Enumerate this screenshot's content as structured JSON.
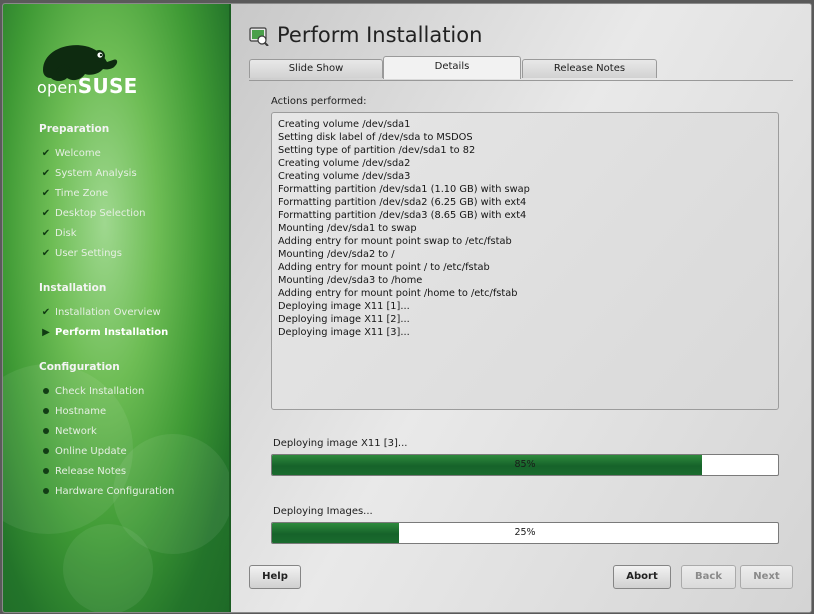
{
  "logo": {
    "prefix": "open",
    "brand": "SUSE"
  },
  "sidebar": {
    "sections": [
      {
        "title": "Preparation",
        "steps": [
          {
            "label": "Welcome",
            "state": "done"
          },
          {
            "label": "System Analysis",
            "state": "done"
          },
          {
            "label": "Time Zone",
            "state": "done"
          },
          {
            "label": "Desktop Selection",
            "state": "done"
          },
          {
            "label": "Disk",
            "state": "done"
          },
          {
            "label": "User Settings",
            "state": "done"
          }
        ]
      },
      {
        "title": "Installation",
        "steps": [
          {
            "label": "Installation Overview",
            "state": "done"
          },
          {
            "label": "Perform Installation",
            "state": "current"
          }
        ]
      },
      {
        "title": "Configuration",
        "steps": [
          {
            "label": "Check Installation",
            "state": "pending"
          },
          {
            "label": "Hostname",
            "state": "pending"
          },
          {
            "label": "Network",
            "state": "pending"
          },
          {
            "label": "Online Update",
            "state": "pending"
          },
          {
            "label": "Release Notes",
            "state": "pending"
          },
          {
            "label": "Hardware Configuration",
            "state": "pending"
          }
        ]
      }
    ]
  },
  "main": {
    "title": "Perform Installation",
    "tabs": [
      {
        "label": "Slide Show",
        "active": false
      },
      {
        "label": "Details",
        "active": true
      },
      {
        "label": "Release Notes",
        "active": false
      }
    ],
    "actions_label": "Actions performed:",
    "log": [
      "Creating volume /dev/sda1",
      "Setting disk label of /dev/sda to MSDOS",
      "Setting type of partition /dev/sda1 to 82",
      "Creating volume /dev/sda2",
      "Creating volume /dev/sda3",
      "Formatting partition /dev/sda1 (1.10 GB) with swap",
      "Formatting partition /dev/sda2 (6.25 GB) with ext4",
      "Formatting partition /dev/sda3 (8.65 GB) with ext4",
      "Mounting /dev/sda1 to swap",
      "Adding entry for mount point swap to /etc/fstab",
      "Mounting /dev/sda2 to /",
      "Adding entry for mount point / to /etc/fstab",
      "Mounting /dev/sda3 to /home",
      "Adding entry for mount point /home to /etc/fstab",
      "Deploying image X11 [1]...",
      "Deploying image X11 [2]...",
      "Deploying image X11 [3]..."
    ],
    "progress": [
      {
        "label": "Deploying image X11 [3]...",
        "percent_text": "85%",
        "value": 85
      },
      {
        "label": "Deploying Images...",
        "percent_text": "25%",
        "value": 25
      }
    ]
  },
  "buttons": {
    "help": "Help",
    "abort": "Abort",
    "back": "Back",
    "next": "Next"
  },
  "colors": {
    "sidebar_green": "#3f9a35",
    "progress_fill": "#16622a",
    "check_mark": "#103b12"
  }
}
